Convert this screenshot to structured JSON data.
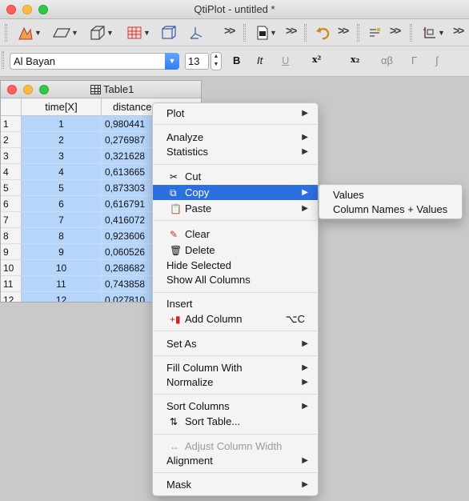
{
  "window": {
    "title": "QtiPlot - untitled *"
  },
  "format_bar": {
    "font_name": "Al Bayan",
    "font_size": "13",
    "bold": "B",
    "italic": "It",
    "underline": "U",
    "superscript": "x²",
    "subscript": "x₂",
    "greek_lower": "αβ",
    "greek_upper": "Γ",
    "integral": "∫"
  },
  "table_window": {
    "title": "Table1",
    "columns": [
      "time[X]",
      "distance"
    ],
    "rows": [
      {
        "n": "1",
        "time": "1",
        "distance": "0,980441"
      },
      {
        "n": "2",
        "time": "2",
        "distance": "0,276987"
      },
      {
        "n": "3",
        "time": "3",
        "distance": "0,321628"
      },
      {
        "n": "4",
        "time": "4",
        "distance": "0,613665"
      },
      {
        "n": "5",
        "time": "5",
        "distance": "0,873303"
      },
      {
        "n": "6",
        "time": "6",
        "distance": "0,616791"
      },
      {
        "n": "7",
        "time": "7",
        "distance": "0,416072"
      },
      {
        "n": "8",
        "time": "8",
        "distance": "0,923606"
      },
      {
        "n": "9",
        "time": "9",
        "distance": "0,060526"
      },
      {
        "n": "10",
        "time": "10",
        "distance": "0,268682"
      },
      {
        "n": "11",
        "time": "11",
        "distance": "0,743858"
      },
      {
        "n": "12",
        "time": "12",
        "distance": "0,027810"
      }
    ]
  },
  "context_menu": {
    "items": [
      {
        "label": "Plot"
      },
      {
        "label": "Analyze"
      },
      {
        "label": "Statistics"
      },
      {
        "label": "Cut"
      },
      {
        "label": "Copy"
      },
      {
        "label": "Paste"
      },
      {
        "label": "Clear"
      },
      {
        "label": "Delete"
      },
      {
        "label": "Hide Selected"
      },
      {
        "label": "Show All Columns"
      },
      {
        "label": "Insert"
      },
      {
        "label": "Add Column",
        "shortcut": "⌥C"
      },
      {
        "label": "Set As"
      },
      {
        "label": "Fill Column With"
      },
      {
        "label": "Normalize"
      },
      {
        "label": "Sort Columns"
      },
      {
        "label": "Sort Table..."
      },
      {
        "label": "Adjust Column Width"
      },
      {
        "label": "Alignment"
      },
      {
        "label": "Mask"
      }
    ]
  },
  "copy_submenu": {
    "items": [
      {
        "label": "Values"
      },
      {
        "label": "Column Names + Values"
      }
    ]
  },
  "colors": {
    "highlight": "#2c6fe0",
    "selection": "#b6d5fb"
  }
}
